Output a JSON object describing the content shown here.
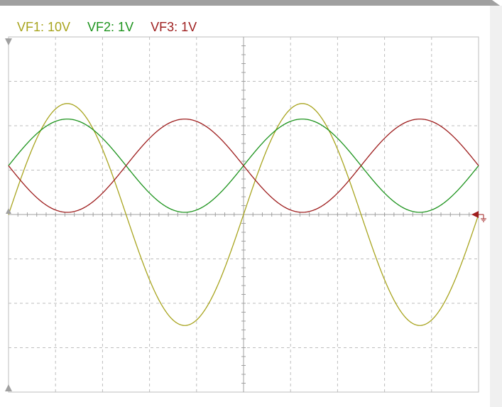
{
  "channels": [
    {
      "label": "VF1: 10V",
      "color": "#a8a41e"
    },
    {
      "label": "VF2: 1V",
      "color": "#1e941e"
    },
    {
      "label": "VF3: 1V",
      "color": "#9e1e1e"
    }
  ],
  "colors": {
    "grid": "#bdbdbd",
    "axis": "#a0a0a0",
    "marker": "#9e1e1e",
    "background": "#ffffff"
  },
  "chart_data": {
    "type": "line",
    "title": "",
    "xlabel": "",
    "ylabel": "",
    "grid": true,
    "x_divisions": 10,
    "y_divisions": 8,
    "ylim": [
      -4,
      4
    ],
    "series": [
      {
        "name": "VF1: 10V",
        "color": "#a8a41e",
        "shape": "sine",
        "offset": 0.0,
        "amplitude": 2.5,
        "cycles": 2,
        "phase_deg": 0
      },
      {
        "name": "VF2: 1V",
        "color": "#1e941e",
        "shape": "sine",
        "offset": 1.1,
        "amplitude": 1.05,
        "cycles": 2,
        "phase_deg": 0
      },
      {
        "name": "VF3: 1V",
        "color": "#9e1e1e",
        "shape": "sine",
        "offset": 1.1,
        "amplitude": 1.05,
        "cycles": 2,
        "phase_deg": 180
      }
    ],
    "ground_marker": {
      "channel": "VF3: 1V",
      "level": 0
    }
  }
}
